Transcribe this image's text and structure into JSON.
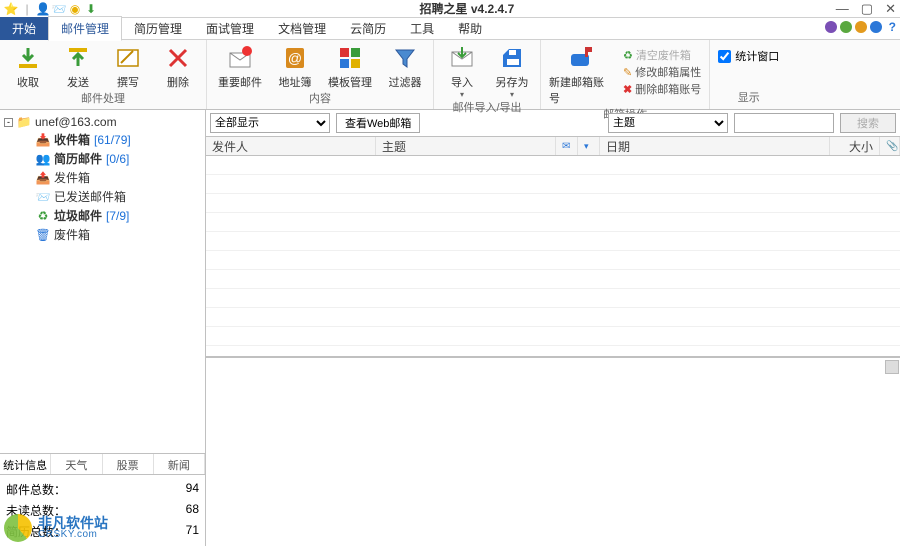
{
  "titlebar": {
    "title": "招聘之星 v4.2.4.7"
  },
  "menus": {
    "start": "开始",
    "mail": "邮件管理",
    "resume": "简历管理",
    "interview": "面试管理",
    "doc": "文档管理",
    "cloud": "云简历",
    "tool": "工具",
    "help": "帮助"
  },
  "ribbon": {
    "group_mail": {
      "name": "邮件处理",
      "receive": "收取",
      "send": "发送",
      "compose": "撰写",
      "delete": "删除"
    },
    "group_content": {
      "name": "内容",
      "important": "重要邮件",
      "addrbook": "地址簿",
      "template": "模板管理",
      "filter": "过滤器"
    },
    "group_io": {
      "name": "邮件导入/导出",
      "import": "导入",
      "saveas": "另存为"
    },
    "group_acct": {
      "name": "邮箱操作",
      "newacct": "新建邮箱账号",
      "emptytrash": "清空废件箱",
      "editacct": "修改邮箱属性",
      "delacct": "删除邮箱账号"
    },
    "group_display": {
      "name": "显示",
      "statswin": "统计窗口"
    }
  },
  "tree": {
    "account": "unef@163.com",
    "inbox": {
      "label": "收件箱",
      "count": "[61/79]"
    },
    "resume": {
      "label": "简历邮件",
      "count": "[0/6]"
    },
    "outbox": {
      "label": "发件箱"
    },
    "sent": {
      "label": "已发送邮件箱"
    },
    "junk": {
      "label": "垃圾邮件",
      "count": "[7/9]"
    },
    "trash": {
      "label": "废件箱"
    }
  },
  "sidebar_tabs": {
    "stats": "统计信息",
    "weather": "天气",
    "stock": "股票",
    "news": "新闻"
  },
  "stats": {
    "mail_total_label": "邮件总数：",
    "mail_total": "94",
    "unread_label": "未读总数：",
    "unread": "68",
    "resume_label": "简历总数：",
    "resume": "71"
  },
  "filter": {
    "showall": "全部显示",
    "viewweb": "查看Web邮箱",
    "subject": "主题",
    "search_placeholder": "",
    "search_btn": "搜索"
  },
  "columns": {
    "sender": "发件人",
    "subject": "主题",
    "date": "日期",
    "size": "大小"
  },
  "watermark": {
    "cn": "非凡软件站",
    "en": "CRSKY.com"
  }
}
